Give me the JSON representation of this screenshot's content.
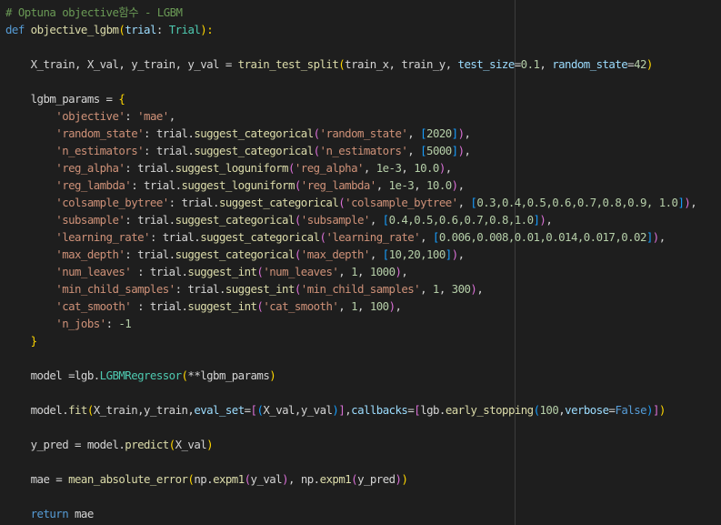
{
  "editor": {
    "theme": {
      "background": "#1e1e1e",
      "text": "#d4d4d4",
      "comment": "#6a9955",
      "keyword": "#569cd6",
      "function": "#dcdcaa",
      "string": "#ce9178",
      "number": "#b5cea8",
      "class": "#4ec9b0",
      "variable": "#9cdcfe",
      "bracket_level1": "#ffd700",
      "bracket_level2": "#da70d6",
      "bracket_level3": "#179fff"
    },
    "lines": [
      [
        [
          "# Optuna objective함수 - LGBM",
          "cmt"
        ]
      ],
      [
        [
          "def",
          "kw"
        ],
        [
          " ",
          "pun"
        ],
        [
          "objective_lgbm",
          "fn"
        ],
        [
          "(",
          "br1"
        ],
        [
          "trial",
          "var"
        ],
        [
          ": ",
          "pun"
        ],
        [
          "Trial",
          "cls"
        ],
        [
          "):",
          "br1"
        ]
      ],
      [],
      [
        [
          "    X_train, X_val, y_train, y_val = ",
          "pun"
        ],
        [
          "train_test_split",
          "fn"
        ],
        [
          "(",
          "br1"
        ],
        [
          "train_x, train_y, ",
          "pun"
        ],
        [
          "test_size",
          "var"
        ],
        [
          "=",
          "pun"
        ],
        [
          "0.1",
          "num"
        ],
        [
          ", ",
          "pun"
        ],
        [
          "random_state",
          "var"
        ],
        [
          "=",
          "pun"
        ],
        [
          "42",
          "num"
        ],
        [
          ")",
          "br1"
        ]
      ],
      [],
      [
        [
          "    lgbm_params = ",
          "pun"
        ],
        [
          "{",
          "br1"
        ]
      ],
      [
        [
          "        ",
          "pun"
        ],
        [
          "'objective'",
          "str"
        ],
        [
          ": ",
          "pun"
        ],
        [
          "'mae'",
          "str"
        ],
        [
          ",",
          "pun"
        ]
      ],
      [
        [
          "        ",
          "pun"
        ],
        [
          "'random_state'",
          "str"
        ],
        [
          ": trial.",
          "pun"
        ],
        [
          "suggest_categorical",
          "fn"
        ],
        [
          "(",
          "br2"
        ],
        [
          "'random_state'",
          "str"
        ],
        [
          ", ",
          "pun"
        ],
        [
          "[",
          "br3"
        ],
        [
          "2020",
          "num"
        ],
        [
          "]",
          "br3"
        ],
        [
          ")",
          "br2"
        ],
        [
          ",",
          "pun"
        ]
      ],
      [
        [
          "        ",
          "pun"
        ],
        [
          "'n_estimators'",
          "str"
        ],
        [
          ": trial.",
          "pun"
        ],
        [
          "suggest_categorical",
          "fn"
        ],
        [
          "(",
          "br2"
        ],
        [
          "'n_estimators'",
          "str"
        ],
        [
          ", ",
          "pun"
        ],
        [
          "[",
          "br3"
        ],
        [
          "5000",
          "num"
        ],
        [
          "]",
          "br3"
        ],
        [
          ")",
          "br2"
        ],
        [
          ",",
          "pun"
        ]
      ],
      [
        [
          "        ",
          "pun"
        ],
        [
          "'reg_alpha'",
          "str"
        ],
        [
          ": trial.",
          "pun"
        ],
        [
          "suggest_loguniform",
          "fn"
        ],
        [
          "(",
          "br2"
        ],
        [
          "'reg_alpha'",
          "str"
        ],
        [
          ", ",
          "pun"
        ],
        [
          "1e-3",
          "num"
        ],
        [
          ", ",
          "pun"
        ],
        [
          "10.0",
          "num"
        ],
        [
          ")",
          "br2"
        ],
        [
          ",",
          "pun"
        ]
      ],
      [
        [
          "        ",
          "pun"
        ],
        [
          "'reg_lambda'",
          "str"
        ],
        [
          ": trial.",
          "pun"
        ],
        [
          "suggest_loguniform",
          "fn"
        ],
        [
          "(",
          "br2"
        ],
        [
          "'reg_lambda'",
          "str"
        ],
        [
          ", ",
          "pun"
        ],
        [
          "1e-3",
          "num"
        ],
        [
          ", ",
          "pun"
        ],
        [
          "10.0",
          "num"
        ],
        [
          ")",
          "br2"
        ],
        [
          ",",
          "pun"
        ]
      ],
      [
        [
          "        ",
          "pun"
        ],
        [
          "'colsample_bytree'",
          "str"
        ],
        [
          ": trial.",
          "pun"
        ],
        [
          "suggest_categorical",
          "fn"
        ],
        [
          "(",
          "br2"
        ],
        [
          "'colsample_bytree'",
          "str"
        ],
        [
          ", ",
          "pun"
        ],
        [
          "[",
          "br3"
        ],
        [
          "0.3,0.4,0.5,0.6,0.7,0.8,0.9, 1.0",
          "num"
        ],
        [
          "]",
          "br3"
        ],
        [
          ")",
          "br2"
        ],
        [
          ",",
          "pun"
        ]
      ],
      [
        [
          "        ",
          "pun"
        ],
        [
          "'subsample'",
          "str"
        ],
        [
          ": trial.",
          "pun"
        ],
        [
          "suggest_categorical",
          "fn"
        ],
        [
          "(",
          "br2"
        ],
        [
          "'subsample'",
          "str"
        ],
        [
          ", ",
          "pun"
        ],
        [
          "[",
          "br3"
        ],
        [
          "0.4,0.5,0.6,0.7,0.8,1.0",
          "num"
        ],
        [
          "]",
          "br3"
        ],
        [
          ")",
          "br2"
        ],
        [
          ",",
          "pun"
        ]
      ],
      [
        [
          "        ",
          "pun"
        ],
        [
          "'learning_rate'",
          "str"
        ],
        [
          ": trial.",
          "pun"
        ],
        [
          "suggest_categorical",
          "fn"
        ],
        [
          "(",
          "br2"
        ],
        [
          "'learning_rate'",
          "str"
        ],
        [
          ", ",
          "pun"
        ],
        [
          "[",
          "br3"
        ],
        [
          "0.006,0.008,0.01,0.014,0.017,0.02",
          "num"
        ],
        [
          "]",
          "br3"
        ],
        [
          ")",
          "br2"
        ],
        [
          ",",
          "pun"
        ]
      ],
      [
        [
          "        ",
          "pun"
        ],
        [
          "'max_depth'",
          "str"
        ],
        [
          ": trial.",
          "pun"
        ],
        [
          "suggest_categorical",
          "fn"
        ],
        [
          "(",
          "br2"
        ],
        [
          "'max_depth'",
          "str"
        ],
        [
          ", ",
          "pun"
        ],
        [
          "[",
          "br3"
        ],
        [
          "10,20,100",
          "num"
        ],
        [
          "]",
          "br3"
        ],
        [
          ")",
          "br2"
        ],
        [
          ",",
          "pun"
        ]
      ],
      [
        [
          "        ",
          "pun"
        ],
        [
          "'num_leaves'",
          "str"
        ],
        [
          " : trial.",
          "pun"
        ],
        [
          "suggest_int",
          "fn"
        ],
        [
          "(",
          "br2"
        ],
        [
          "'num_leaves'",
          "str"
        ],
        [
          ", ",
          "pun"
        ],
        [
          "1",
          "num"
        ],
        [
          ", ",
          "pun"
        ],
        [
          "1000",
          "num"
        ],
        [
          ")",
          "br2"
        ],
        [
          ",",
          "pun"
        ]
      ],
      [
        [
          "        ",
          "pun"
        ],
        [
          "'min_child_samples'",
          "str"
        ],
        [
          ": trial.",
          "pun"
        ],
        [
          "suggest_int",
          "fn"
        ],
        [
          "(",
          "br2"
        ],
        [
          "'min_child_samples'",
          "str"
        ],
        [
          ", ",
          "pun"
        ],
        [
          "1",
          "num"
        ],
        [
          ", ",
          "pun"
        ],
        [
          "300",
          "num"
        ],
        [
          ")",
          "br2"
        ],
        [
          ",",
          "pun"
        ]
      ],
      [
        [
          "        ",
          "pun"
        ],
        [
          "'cat_smooth'",
          "str"
        ],
        [
          " : trial.",
          "pun"
        ],
        [
          "suggest_int",
          "fn"
        ],
        [
          "(",
          "br2"
        ],
        [
          "'cat_smooth'",
          "str"
        ],
        [
          ", ",
          "pun"
        ],
        [
          "1",
          "num"
        ],
        [
          ", ",
          "pun"
        ],
        [
          "100",
          "num"
        ],
        [
          ")",
          "br2"
        ],
        [
          ",",
          "pun"
        ]
      ],
      [
        [
          "        ",
          "pun"
        ],
        [
          "'n_jobs'",
          "str"
        ],
        [
          ": ",
          "pun"
        ],
        [
          "-1",
          "num"
        ]
      ],
      [
        [
          "    ",
          "pun"
        ],
        [
          "}",
          "br1"
        ]
      ],
      [],
      [
        [
          "    model =lgb.",
          "pun"
        ],
        [
          "LGBMRegressor",
          "cls"
        ],
        [
          "(",
          "br1"
        ],
        [
          "**lgbm_params",
          "pun"
        ],
        [
          ")",
          "br1"
        ]
      ],
      [],
      [
        [
          "    model.",
          "pun"
        ],
        [
          "fit",
          "fn"
        ],
        [
          "(",
          "br1"
        ],
        [
          "X_train,y_train,",
          "pun"
        ],
        [
          "eval_set",
          "var"
        ],
        [
          "=",
          "pun"
        ],
        [
          "[",
          "br2"
        ],
        [
          "(",
          "br3"
        ],
        [
          "X_val,y_val",
          "pun"
        ],
        [
          ")",
          "br3"
        ],
        [
          "]",
          "br2"
        ],
        [
          ",",
          "pun"
        ],
        [
          "callbacks",
          "var"
        ],
        [
          "=",
          "pun"
        ],
        [
          "[",
          "br2"
        ],
        [
          "lgb.",
          "pun"
        ],
        [
          "early_stopping",
          "fn"
        ],
        [
          "(",
          "br3"
        ],
        [
          "100",
          "num"
        ],
        [
          ",",
          "pun"
        ],
        [
          "verbose",
          "var"
        ],
        [
          "=",
          "pun"
        ],
        [
          "False",
          "kw"
        ],
        [
          ")",
          "br3"
        ],
        [
          "]",
          "br2"
        ],
        [
          ")",
          "br1"
        ]
      ],
      [],
      [
        [
          "    y_pred = model.",
          "pun"
        ],
        [
          "predict",
          "fn"
        ],
        [
          "(",
          "br1"
        ],
        [
          "X_val",
          "pun"
        ],
        [
          ")",
          "br1"
        ]
      ],
      [],
      [
        [
          "    mae = ",
          "pun"
        ],
        [
          "mean_absolute_error",
          "fn"
        ],
        [
          "(",
          "br1"
        ],
        [
          "np.",
          "pun"
        ],
        [
          "expm1",
          "fn"
        ],
        [
          "(",
          "br2"
        ],
        [
          "y_val",
          "pun"
        ],
        [
          ")",
          "br2"
        ],
        [
          ", np.",
          "pun"
        ],
        [
          "expm1",
          "fn"
        ],
        [
          "(",
          "br2"
        ],
        [
          "y_pred",
          "pun"
        ],
        [
          ")",
          "br2"
        ],
        [
          ")",
          "br1"
        ]
      ],
      [],
      [
        [
          "    ",
          "pun"
        ],
        [
          "return",
          "kw"
        ],
        [
          " mae",
          "pun"
        ]
      ]
    ]
  }
}
